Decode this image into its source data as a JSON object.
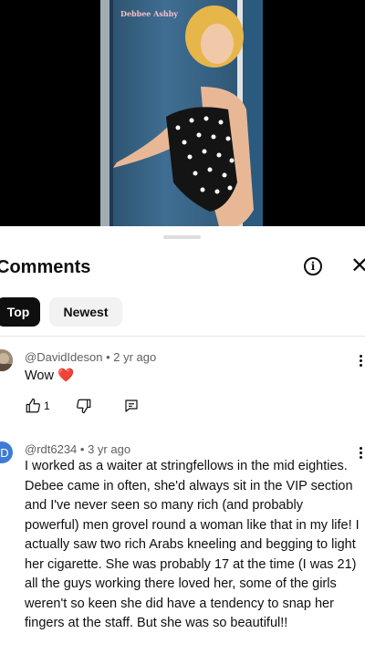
{
  "video": {
    "poster_title": "Debbee Ashby"
  },
  "comments_panel": {
    "title": "Comments",
    "sort_tabs": [
      "Top",
      "Newest"
    ]
  },
  "comments": [
    {
      "author": "@DavidIdeson",
      "age": "2 yr ago",
      "text": "Wow",
      "emoji": "❤️",
      "likes": "1"
    },
    {
      "author": "@rdt6234",
      "age": "3 yr ago",
      "avatar_letter": "D",
      "avatar_color": "#3f7bd6",
      "text": "I worked as a waiter at stringfellows in the mid eighties. Debee came in often, she'd always sit in the VIP section and I've never seen so many rich (and probably powerful) men grovel round a woman like that in my life! I actually saw two rich Arabs kneeling and begging to light her cigarette. She was probably 17 at the time (I was 21) all the guys working there loved her, some of the girls weren't so keen she did have a tendency to snap her fingers at the staff. But she was so beautiful!!"
    }
  ]
}
